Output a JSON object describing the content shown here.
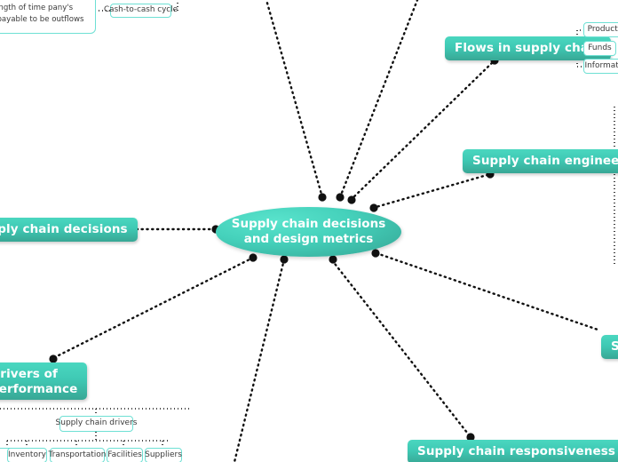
{
  "map": {
    "title": "Supply chain decisions and design metrics",
    "center": {
      "line1": "Supply chain decisions",
      "line2": "and design metrics"
    },
    "branches": {
      "flows_in_supply_chain": {
        "label": "Flows in supply chain",
        "children": [
          "Products",
          "Funds",
          "Information"
        ]
      },
      "supply_chain_engineering": {
        "label": "Supply chain engineering"
      },
      "supply_chain_responsiveness": {
        "label": "Supply chain responsiveness"
      },
      "supply_chain_decisions": {
        "label": "Supply chain decisions",
        "clipped_visible": "pply chain decisions"
      },
      "drivers_of_performance": {
        "label_line1": "Drivers of",
        "label_line2": "performance",
        "clipped_visible_line1": "Drivers of",
        "clipped_visible_line2": "erformance",
        "children": {
          "supply_chain_drivers": {
            "label": "Supply chain drivers",
            "children": [
              "Inventory",
              "Transportation",
              "Facilities",
              "Suppliers"
            ]
          }
        }
      },
      "right_edge_clipped": {
        "clipped_visible": "Su"
      }
    },
    "notes": {
      "cash_to_cash_cycle": {
        "label": "Cash-to-cash cycle",
        "description": "accounts receivable to be inflows and the length of time pany's accounts payable to be outflows"
      }
    }
  },
  "colors": {
    "topic_fill_top": "#4ad7c0",
    "topic_fill_bottom": "#38a795",
    "topic_text": "#ffffff",
    "subbox_border": "#6ee0d4",
    "subbox_text": "#3a3a3a",
    "edge": "#111111",
    "background": "#ffffff"
  }
}
